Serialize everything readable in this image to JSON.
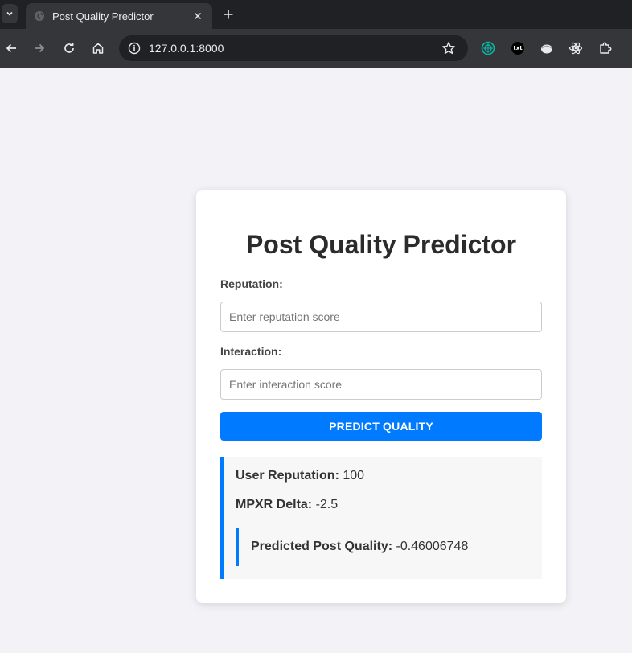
{
  "browser": {
    "tab_title": "Post Quality Predictor",
    "url": "127.0.0.1:8000",
    "extensions": [
      {
        "icon": "codeium-icon",
        "color": "#09b6a2"
      },
      {
        "icon": "txt-extension-icon",
        "text": "txt"
      },
      {
        "icon": "coconut-icon"
      },
      {
        "icon": "react-devtools-icon"
      },
      {
        "icon": "puzzle-piece-icon"
      }
    ]
  },
  "page": {
    "title": "Post Quality Predictor",
    "form": {
      "reputation_label": "Reputation:",
      "reputation_placeholder": "Enter reputation score",
      "reputation_value": "",
      "interaction_label": "Interaction:",
      "interaction_placeholder": "Enter interaction score",
      "interaction_value": "",
      "submit_label": "PREDICT QUALITY"
    },
    "result": {
      "user_reputation_label": "User Reputation:",
      "user_reputation_value": "100",
      "mpxr_delta_label": "MPXR Delta:",
      "mpxr_delta_value": "-2.5",
      "predicted_label": "Predicted Post Quality:",
      "predicted_value": "-0.46006748"
    }
  },
  "colors": {
    "accent": "#007bff",
    "page_background": "#f2f2f7",
    "card_background": "#ffffff",
    "result_background": "#f7f7f7"
  }
}
